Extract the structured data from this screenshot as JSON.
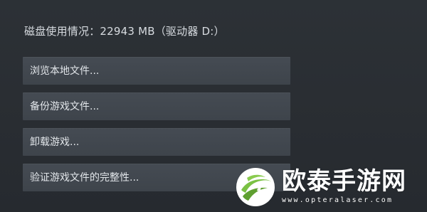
{
  "disk_usage": {
    "text": "磁盘使用情况：22943 MB（驱动器 D:）"
  },
  "menu": {
    "items": [
      {
        "label": "浏览本地文件..."
      },
      {
        "label": "备份游戏文件..."
      },
      {
        "label": "卸载游戏..."
      },
      {
        "label": "验证游戏文件的完整性..."
      }
    ]
  },
  "watermark": {
    "title": "欧泰手游网",
    "url": "www.opteralaser.com",
    "logo_icon": "green-globe-logo-icon"
  },
  "colors": {
    "background": "#2b2f34",
    "menu_item": "#434950",
    "text": "#e2e6ea",
    "logo_green": "#7ac143"
  }
}
